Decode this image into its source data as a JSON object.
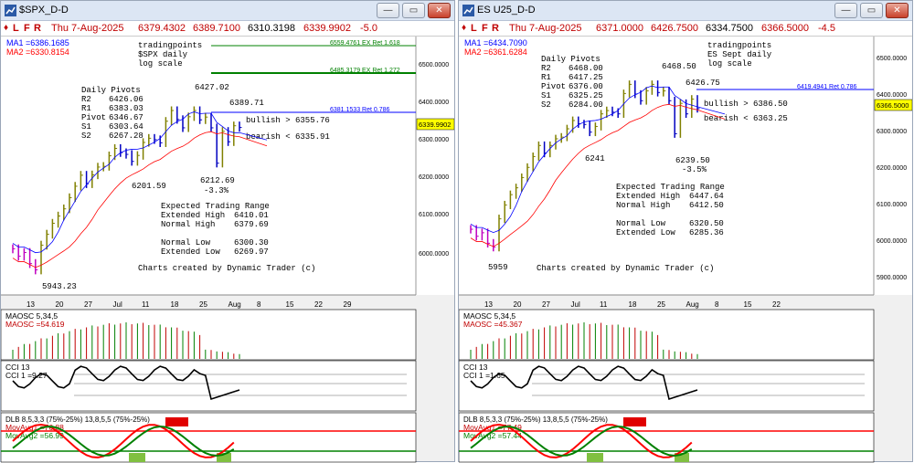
{
  "windows": [
    {
      "title": "$SPX_D-D",
      "infobar": {
        "marks": [
          "L",
          "F",
          "R"
        ],
        "date": "Thu 7-Aug-2025",
        "open": "6379.4302",
        "high": "6389.7100",
        "low": "6310.3198",
        "close": "6339.9902",
        "change": "-5.0"
      },
      "ma": [
        {
          "label": "MA1 =6386.1685",
          "color": "#0000ff"
        },
        {
          "label": "MA2 =6330.8154",
          "color": "#ff0000"
        }
      ],
      "header_lines": [
        "tradingpoints",
        "$SPX daily",
        "log scale"
      ],
      "pivots": {
        "title": "Daily Pivots",
        "rows": [
          [
            "R2",
            "6426.06"
          ],
          [
            "R1",
            "6383.03"
          ],
          [
            "Pivot",
            "6346.67"
          ],
          [
            "S1",
            "6303.64"
          ],
          [
            "S2",
            "6267.28"
          ]
        ]
      },
      "range": {
        "title": "Expected Trading Range",
        "rows": [
          [
            "Extended High",
            "6410.01"
          ],
          [
            "Normal High",
            "6379.69"
          ],
          [
            "",
            ""
          ],
          [
            "Normal Low",
            "6300.30"
          ],
          [
            "Extended Low",
            "6269.97"
          ]
        ]
      },
      "bullish": "bullish > 6355.76",
      "bearish": "bearish < 6335.91",
      "credit": "Charts created by Dynamic Trader (c)",
      "price_annotations": [
        "6427.02",
        "6389.71",
        "6201.59",
        "6212.69",
        "-3.3%",
        "5943.23"
      ],
      "ret_lines": [
        {
          "label": "6559.4761 EX Ret 1.618",
          "color": "#008000"
        },
        {
          "label": "6485.3179 EX Ret 1.272",
          "color": "#008000"
        },
        {
          "label": "6381.1533 Ret 0.786",
          "color": "#0000ff"
        }
      ],
      "price_axis": [
        "6500.0000",
        "6400.0000",
        "6300.0000",
        "6200.0000",
        "6100.0000",
        "6000.0000"
      ],
      "last_price": "6339.9902",
      "date_axis": [
        "13",
        "20",
        "27",
        "Jul",
        "11",
        "18",
        "25",
        "Aug",
        "8",
        "15",
        "22",
        "29"
      ],
      "maosc": {
        "title": "MAOSC 5,34,5",
        "value": "MAOSC =54.619"
      },
      "cci": {
        "title": "CCI 13",
        "value": "CCI 1 =9.27"
      },
      "dlb": {
        "title": "DLB 8,5,3,3 (75%-25%) 13,8,5,5 (75%-25%)",
        "avg1": "MovAvg1 =76.88",
        "avg2": "MovAvg2 =56.99"
      },
      "chart_data": {
        "type": "candlestick",
        "price_scale": "log",
        "ohlc_closes": [
          6000,
          5980,
          5990,
          5960,
          5943,
          6010,
          6040,
          6070,
          6090,
          6110,
          6141,
          6173,
          6204,
          6180,
          6205,
          6227,
          6229,
          6259,
          6280,
          6268,
          6263,
          6243,
          6260,
          6297,
          6309,
          6305,
          6296,
          6358,
          6389,
          6363,
          6339,
          6371,
          6389,
          6362,
          6370,
          6339,
          6238,
          6329,
          6299,
          6345,
          6340
        ],
        "ma1": 6386.1685,
        "ma2": 6330.8154
      }
    },
    {
      "title": "ES U25_D-D",
      "infobar": {
        "marks": [
          "L",
          "F",
          "R"
        ],
        "date": "Thu 7-Aug-2025",
        "open": "6371.0000",
        "high": "6426.7500",
        "low": "6334.7500",
        "close": "6366.5000",
        "change": "-4.5"
      },
      "ma": [
        {
          "label": "MA1 =6434.7090",
          "color": "#0000ff"
        },
        {
          "label": "MA2 =6361.6284",
          "color": "#ff0000"
        }
      ],
      "header_lines": [
        "tradingpoints",
        "ES Sept daily",
        "log scale"
      ],
      "pivots": {
        "title": "Daily Pivots",
        "rows": [
          [
            "R2",
            "6468.00"
          ],
          [
            "R1",
            "6417.25"
          ],
          [
            "Pivot",
            "6376.00"
          ],
          [
            "S1",
            "6325.25"
          ],
          [
            "S2",
            "6284.00"
          ]
        ]
      },
      "range": {
        "title": "Expected Trading Range",
        "rows": [
          [
            "Extended High",
            "6447.64"
          ],
          [
            "Normal High",
            "6412.50"
          ],
          [
            "",
            ""
          ],
          [
            "Normal Low",
            "6320.50"
          ],
          [
            "Extended Low",
            "6285.36"
          ]
        ]
      },
      "bullish": "bullish > 6386.50",
      "bearish": "bearish < 6363.25",
      "credit": "Charts created by Dynamic Trader (c)",
      "price_annotations": [
        "6468.50",
        "6426.75",
        "6241",
        "6239.50",
        "-3.5%",
        "5959"
      ],
      "ret_lines": [
        {
          "label": "6419.4941 Ret 0.786",
          "color": "#0000ff"
        }
      ],
      "price_axis": [
        "6500.0000",
        "6400.0000",
        "6300.0000",
        "6200.0000",
        "6100.0000",
        "6000.0000",
        "5900.0000"
      ],
      "last_price": "6366.5000",
      "date_axis": [
        "13",
        "20",
        "27",
        "Jul",
        "11",
        "18",
        "25",
        "Aug",
        "8",
        "15",
        "22"
      ],
      "maosc": {
        "title": "MAOSC 5,34,5",
        "value": "MAOSC =45.367"
      },
      "cci": {
        "title": "CCI 13",
        "value": "CCI 1 =1.65"
      },
      "dlb": {
        "title": "DLB 8,5,3,3 (75%-25%) 13,8,5,5 (75%-25%)",
        "avg1": "MovAvg1 =77.49",
        "avg2": "MovAvg2 =57.44"
      },
      "chart_data": {
        "type": "candlestick",
        "price_scale": "log",
        "ohlc_closes": [
          6010,
          5990,
          6000,
          5970,
          5959,
          6040,
          6080,
          6110,
          6130,
          6160,
          6190,
          6222,
          6255,
          6232,
          6255,
          6275,
          6280,
          6305,
          6330,
          6320,
          6318,
          6295,
          6312,
          6350,
          6360,
          6355,
          6350,
          6412,
          6440,
          6410,
          6390,
          6420,
          6440,
          6415,
          6420,
          6390,
          6290,
          6382,
          6350,
          6395,
          6366
        ],
        "ma1": 6434.709,
        "ma2": 6361.6284
      }
    }
  ]
}
